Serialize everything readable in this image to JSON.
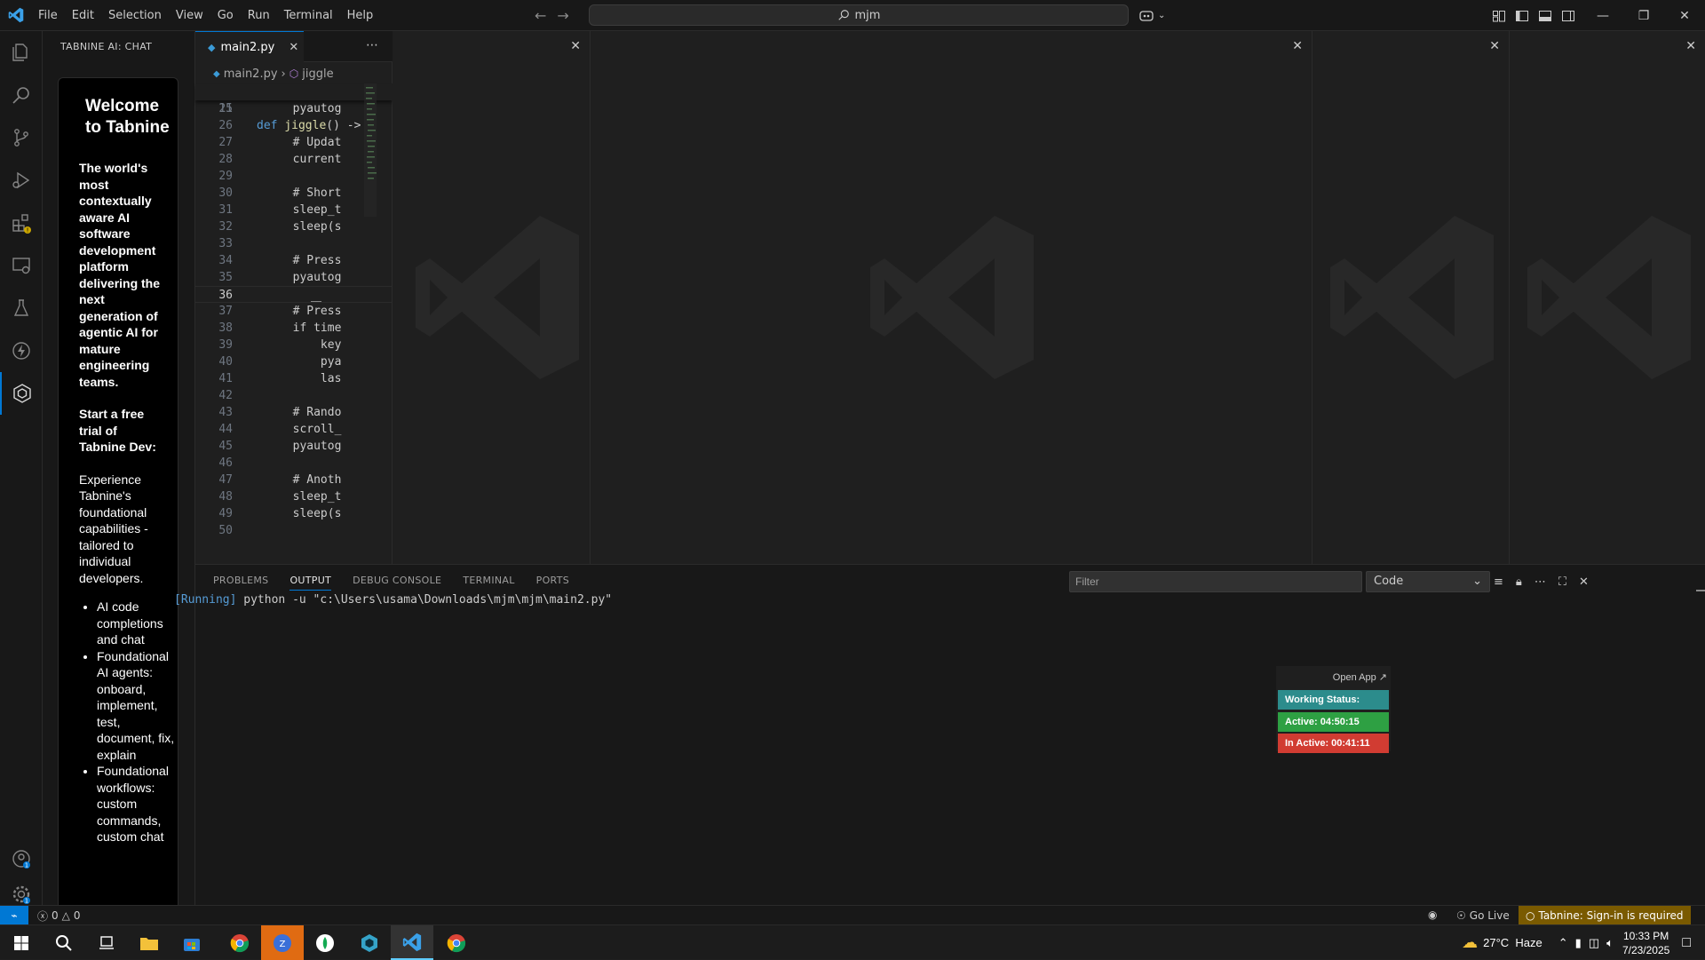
{
  "titlebar": {
    "menu": [
      "File",
      "Edit",
      "Selection",
      "View",
      "Go",
      "Run",
      "Terminal",
      "Help"
    ],
    "search": "mjm"
  },
  "sidebar": {
    "title": "TABNINE AI: CHAT",
    "card": {
      "heading": "Welcome to Tabnine",
      "tagline": "The world's most contextually aware AI software development platform delivering the next generation of agentic AI for mature engineering teams.",
      "trial": "Start a free trial of Tabnine Dev:",
      "description": "Experience Tabnine's foundational capabilities - tailored to individual developers.",
      "bullets": [
        "AI code completions and chat",
        "Foundational AI agents: onboard, implement, test, document, fix, explain",
        "Foundational workflows: custom commands, custom chat"
      ]
    }
  },
  "editor": {
    "tab": "main2.py",
    "breadcrumb_file": "main2.py",
    "breadcrumb_symbol": "jiggle",
    "sticky": {
      "ln": "11",
      "kw": "def",
      "fn": "jiggle",
      "rest": "() ->"
    },
    "lines": [
      {
        "ln": "25",
        "t": "        pyautog",
        "c": "vr"
      },
      {
        "ln": "26",
        "t": "",
        "c": ""
      },
      {
        "ln": "27",
        "t": "        # Updat",
        "c": "cm"
      },
      {
        "ln": "28",
        "t": "        current",
        "c": "vr"
      },
      {
        "ln": "29",
        "t": "",
        "c": ""
      },
      {
        "ln": "30",
        "t": "        # Short",
        "c": "cm"
      },
      {
        "ln": "31",
        "t": "        sleep_t",
        "c": "vr"
      },
      {
        "ln": "32",
        "t": "        sleep(s",
        "c": "fn"
      },
      {
        "ln": "33",
        "t": "",
        "c": ""
      },
      {
        "ln": "34",
        "t": "        # Press",
        "c": "cm"
      },
      {
        "ln": "35",
        "t": "        pyautog",
        "c": "vr"
      },
      {
        "ln": "36",
        "t": "",
        "c": ""
      },
      {
        "ln": "37",
        "t": "        # Press",
        "c": "cm"
      },
      {
        "ln": "38",
        "t": "        if time",
        "c": "ctl"
      },
      {
        "ln": "39",
        "t": "            key",
        "c": "vr"
      },
      {
        "ln": "40",
        "t": "            pya",
        "c": "vr"
      },
      {
        "ln": "41",
        "t": "            las",
        "c": "vr"
      },
      {
        "ln": "42",
        "t": "",
        "c": ""
      },
      {
        "ln": "43",
        "t": "        # Rando",
        "c": "cm"
      },
      {
        "ln": "44",
        "t": "        scroll_",
        "c": "vr"
      },
      {
        "ln": "45",
        "t": "        pyautog",
        "c": "vr"
      },
      {
        "ln": "46",
        "t": "",
        "c": ""
      },
      {
        "ln": "47",
        "t": "        # Anoth",
        "c": "cm"
      },
      {
        "ln": "48",
        "t": "        sleep_t",
        "c": "vr"
      },
      {
        "ln": "49",
        "t": "        sleep(s",
        "c": "fn"
      },
      {
        "ln": "50",
        "t": "",
        "c": ""
      }
    ]
  },
  "panel": {
    "tabs": [
      "PROBLEMS",
      "OUTPUT",
      "DEBUG CONSOLE",
      "TERMINAL",
      "PORTS"
    ],
    "filter_placeholder": "Filter",
    "output_channel": "Code",
    "output_running": "[Running]",
    "output_cmd": "python -u \"c:\\Users\\usama\\Downloads\\mjm\\mjm\\main2.py\""
  },
  "widget": {
    "open_app": "Open App ↗",
    "working_status": "Working Status: Active",
    "active": "Active: 04:50:15",
    "inactive": "In Active: 00:41:11"
  },
  "statusbar": {
    "errors": "0",
    "warnings": "0",
    "go_live": "Go Live",
    "tabnine": "Tabnine: Sign-in is required"
  },
  "taskbar": {
    "weather": "27°C  Haze",
    "time": "10:33 PM",
    "date": "7/23/2025"
  },
  "colors": {
    "accent": "#0078d4",
    "working": "#2c8c8c",
    "active": "#2ea043",
    "inactive": "#d13c32"
  }
}
